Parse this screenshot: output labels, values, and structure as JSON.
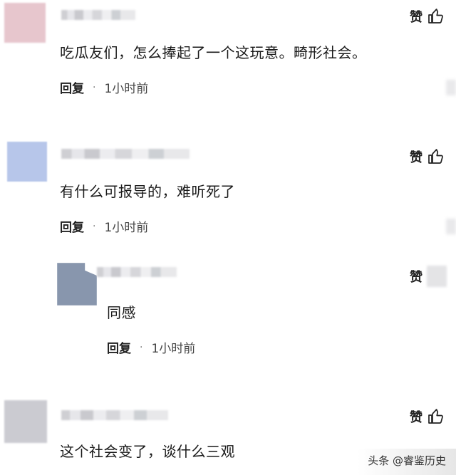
{
  "colors": {
    "avatar_1": "#e7c6cd",
    "avatar_2": "#b7c6ea",
    "avatar_3": "#8896ad",
    "avatar_4": "#cbcbd1"
  },
  "comments": [
    {
      "text": "吃瓜友们，怎么捧起了一个这玩意。畸形社会。",
      "reply": "回复",
      "time": "1小时前",
      "like": "赞"
    },
    {
      "text": "有什么可报导的，难听死了",
      "reply": "回复",
      "time": "1小时前",
      "like": "赞"
    },
    {
      "text": "同感",
      "reply": "回复",
      "time": "1小时前",
      "like": "赞"
    },
    {
      "text": "这个社会变了，谈什么三观",
      "like": "赞"
    }
  ],
  "watermark": "头条 @睿鉴历史",
  "icons": {
    "like": "thumbs-up-icon",
    "separator": "dot-separator"
  }
}
